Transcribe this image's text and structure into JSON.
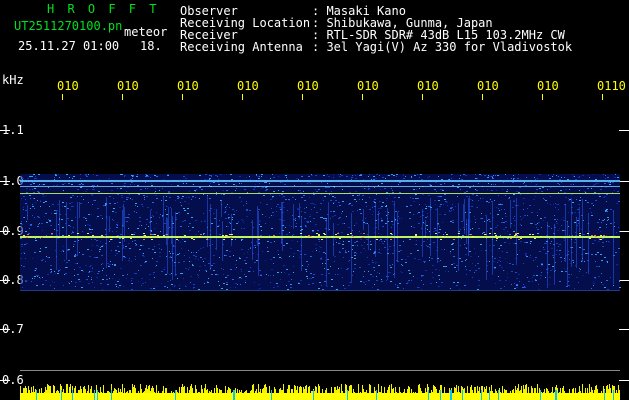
{
  "header": {
    "hrofft": "H R O F F T",
    "filename": "UT2511270100.pn",
    "meteor_label": "meteor",
    "datetime": "25.11.27 01:00",
    "count": "18.",
    "observer_label": "Observer",
    "observer_value": ": Masaki Kano",
    "location_label": "Receiving Location",
    "location_value": ": Shibukawa, Gunma, Japan",
    "receiver_label": "Receiver",
    "receiver_value": ": RTL-SDR SDR# 43dB L15 103.2MHz CW",
    "antenna_label": "Receiving Antenna",
    "antenna_value": ": 3el Yagi(V) Az 330 for Vladivostok"
  },
  "y_axis": {
    "unit": "kHz",
    "ticks": [
      "1.1",
      "1.0",
      "0.9",
      "0.8",
      "0.7",
      "0.6"
    ]
  },
  "time_axis": {
    "labels": [
      "010",
      "010",
      "010",
      "010",
      "010",
      "010",
      "010",
      "010",
      "010",
      "0110"
    ]
  },
  "colors": {
    "background": "#000000",
    "header_green": "#00e020",
    "header_white": "#ffffff",
    "time_labels": "#ffff00",
    "spectrum_base": "#0a1a8c",
    "signal_line": "#c8ff60",
    "yellow_bars": "#ffff00",
    "cyan_ticks": "#00c8ff"
  }
}
